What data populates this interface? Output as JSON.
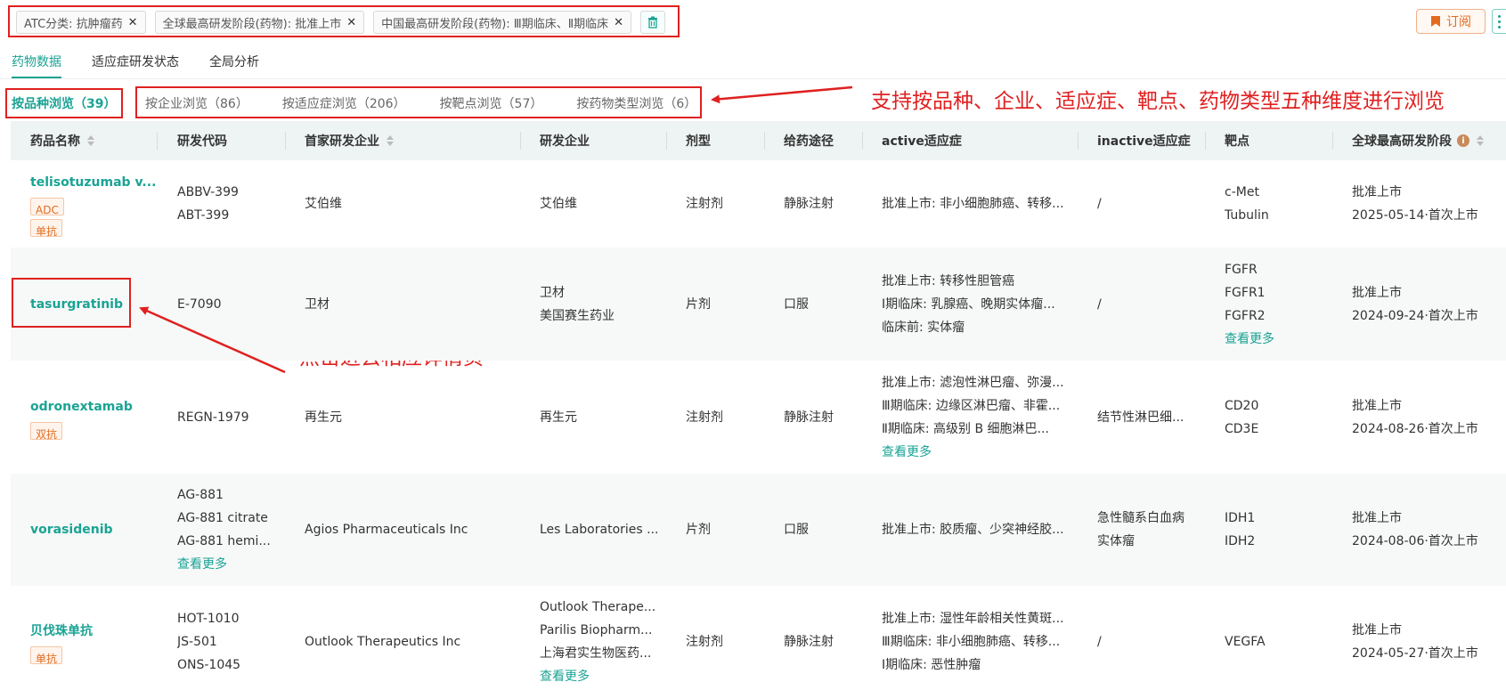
{
  "filters": [
    {
      "label": "ATC分类: 抗肿瘤药"
    },
    {
      "label": "全球最高研发阶段(药物): 批准上市"
    },
    {
      "label": "中国最高研发阶段(药物): Ⅲ期临床、Ⅱ期临床"
    }
  ],
  "subscribe_label": "订阅",
  "tabs": [
    "药物数据",
    "适应症研发状态",
    "全局分析"
  ],
  "browse": {
    "active": "按品种浏览（39）",
    "others": [
      "按企业浏览（86）",
      "按适应症浏览（206）",
      "按靶点浏览（57）",
      "按药物类型浏览（6）"
    ]
  },
  "annotations": {
    "browse_note": "支持按品种、企业、适应症、靶点、药物类型五种维度进行浏览",
    "detail_note": "点击进去相应详情页"
  },
  "columns": [
    "药品名称",
    "研发代码",
    "首家研发企业",
    "研发企业",
    "剂型",
    "给药途径",
    "active适应症",
    "inactive适应症",
    "靶点",
    "全球最高研发阶段"
  ],
  "rows": [
    {
      "name": "telisotuzumab v...",
      "tags": [
        "ADC",
        "单抗"
      ],
      "codes": [
        "ABBV-399",
        "ABT-399"
      ],
      "first_company": "艾伯维",
      "companies": [
        "艾伯维"
      ],
      "dosage": "注射剂",
      "route": "静脉注射",
      "active": [
        "批准上市: 非小细胞肺癌、转移..."
      ],
      "inactive": [
        "/"
      ],
      "targets": [
        "c-Met",
        "Tubulin"
      ],
      "phase": "批准上市",
      "date": "2025-05-14·首次上市"
    },
    {
      "name": "tasurgratinib",
      "tags": [],
      "codes": [
        "E-7090"
      ],
      "first_company": "卫材",
      "companies": [
        "卫材",
        "美国赛生药业"
      ],
      "dosage": "片剂",
      "route": "口服",
      "active": [
        "批准上市: 转移性胆管癌",
        "Ⅰ期临床: 乳腺癌、晚期实体瘤...",
        "临床前: 实体瘤"
      ],
      "inactive": [
        "/"
      ],
      "targets": [
        "FGFR",
        "FGFR1",
        "FGFR2"
      ],
      "targets_more": "查看更多",
      "phase": "批准上市",
      "date": "2024-09-24·首次上市"
    },
    {
      "name": "odronextamab",
      "tags": [
        "双抗"
      ],
      "codes": [
        "REGN-1979"
      ],
      "first_company": "再生元",
      "companies": [
        "再生元"
      ],
      "dosage": "注射剂",
      "route": "静脉注射",
      "active": [
        "批准上市: 滤泡性淋巴瘤、弥漫...",
        "Ⅲ期临床: 边缘区淋巴瘤、非霍...",
        "Ⅱ期临床: 高级别 B 细胞淋巴..."
      ],
      "active_more": "查看更多",
      "inactive": [
        "结节性淋巴细..."
      ],
      "targets": [
        "CD20",
        "CD3E"
      ],
      "phase": "批准上市",
      "date": "2024-08-26·首次上市"
    },
    {
      "name": "vorasidenib",
      "tags": [],
      "codes": [
        "AG-881",
        "AG-881 citrate",
        "AG-881 hemi..."
      ],
      "codes_more": "查看更多",
      "first_company": "Agios Pharmaceuticals Inc",
      "companies": [
        "Les Laboratories ..."
      ],
      "dosage": "片剂",
      "route": "口服",
      "active": [
        "批准上市: 胶质瘤、少突神经胶..."
      ],
      "inactive": [
        "急性髓系白血病",
        "实体瘤"
      ],
      "targets": [
        "IDH1",
        "IDH2"
      ],
      "phase": "批准上市",
      "date": "2024-08-06·首次上市"
    },
    {
      "name": "贝伐珠单抗",
      "tags": [
        "单抗"
      ],
      "codes": [
        "HOT-1010",
        "JS-501",
        "ONS-1045"
      ],
      "first_company": "Outlook Therapeutics Inc",
      "companies": [
        "Outlook Therape...",
        "Parilis Biopharm...",
        "上海君实生物医药..."
      ],
      "companies_more": "查看更多",
      "dosage": "注射剂",
      "route": "静脉注射",
      "active": [
        "批准上市: 湿性年龄相关性黄斑...",
        "Ⅲ期临床: 非小细胞肺癌、转移...",
        "Ⅰ期临床: 恶性肿瘤"
      ],
      "inactive": [
        "/"
      ],
      "targets": [
        "VEGFA"
      ],
      "phase": "批准上市",
      "date": "2024-05-27·首次上市"
    }
  ]
}
